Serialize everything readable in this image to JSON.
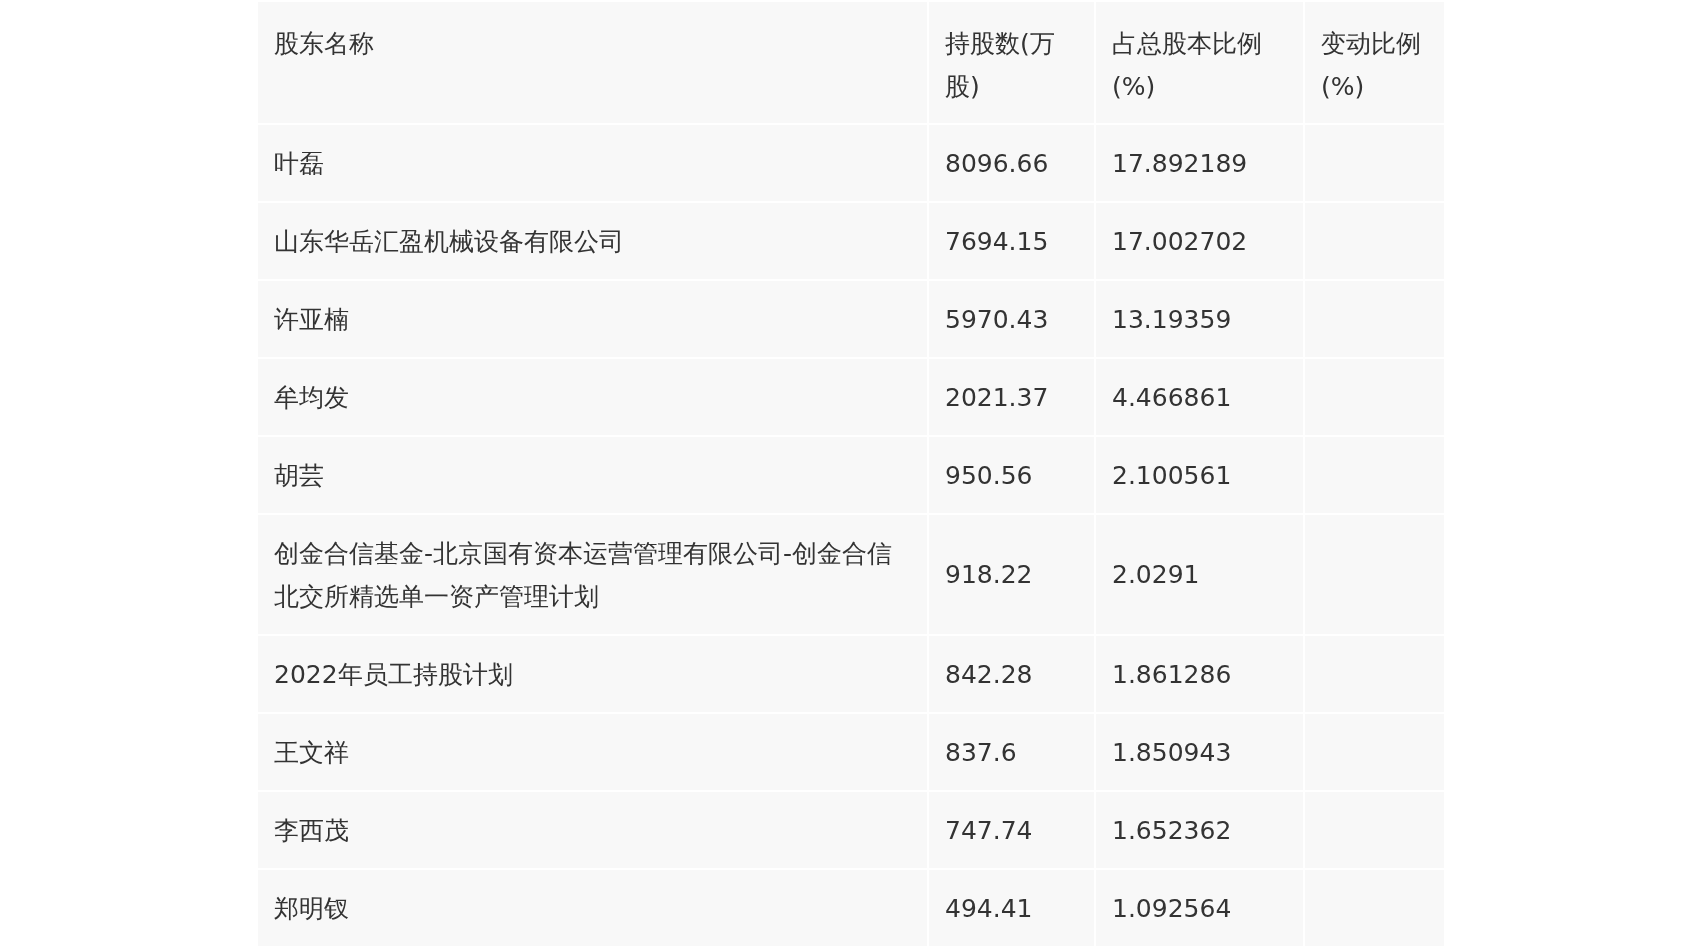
{
  "table": {
    "columns": [
      "股东名称",
      "持股数(万股)",
      "占总股本比例(%)",
      "变动比例(%)"
    ],
    "rows": [
      {
        "name": "叶磊",
        "shares": "8096.66",
        "ratio": "17.892189"
      },
      {
        "name": "山东华岳汇盈机械设备有限公司",
        "shares": "7694.15",
        "ratio": "17.002702"
      },
      {
        "name": "许亚楠",
        "shares": "5970.43",
        "ratio": "13.19359"
      },
      {
        "name": "牟均发",
        "shares": "2021.37",
        "ratio": "4.466861"
      },
      {
        "name": "胡芸",
        "shares": "950.56",
        "ratio": "2.100561"
      },
      {
        "name": "创金合信基金-北京国有资本运营管理有限公司-创金合信北交所精选单一资产管理计划",
        "shares": "918.22",
        "ratio": "2.0291"
      },
      {
        "name": "2022年员工持股计划",
        "shares": "842.28",
        "ratio": "1.861286"
      },
      {
        "name": "王文祥",
        "shares": "837.6",
        "ratio": "1.850943"
      },
      {
        "name": "李西茂",
        "shares": "747.74",
        "ratio": "1.652362"
      },
      {
        "name": "郑明钗",
        "shares": "494.41",
        "ratio": "1.092564"
      }
    ]
  }
}
